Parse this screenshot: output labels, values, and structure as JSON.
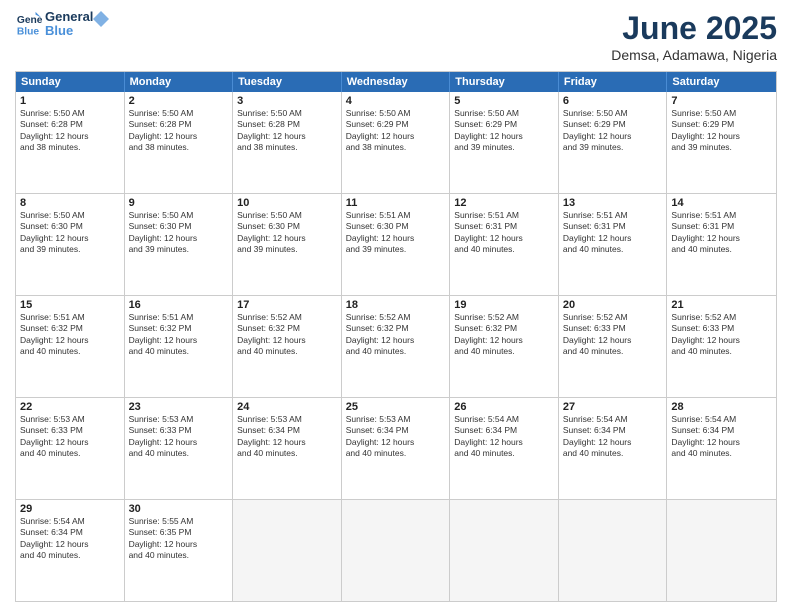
{
  "header": {
    "logo_line1": "General",
    "logo_line2": "Blue",
    "month": "June 2025",
    "location": "Demsa, Adamawa, Nigeria"
  },
  "weekdays": [
    "Sunday",
    "Monday",
    "Tuesday",
    "Wednesday",
    "Thursday",
    "Friday",
    "Saturday"
  ],
  "rows": [
    [
      {
        "day": "1",
        "lines": [
          "Sunrise: 5:50 AM",
          "Sunset: 6:28 PM",
          "Daylight: 12 hours",
          "and 38 minutes."
        ]
      },
      {
        "day": "2",
        "lines": [
          "Sunrise: 5:50 AM",
          "Sunset: 6:28 PM",
          "Daylight: 12 hours",
          "and 38 minutes."
        ]
      },
      {
        "day": "3",
        "lines": [
          "Sunrise: 5:50 AM",
          "Sunset: 6:28 PM",
          "Daylight: 12 hours",
          "and 38 minutes."
        ]
      },
      {
        "day": "4",
        "lines": [
          "Sunrise: 5:50 AM",
          "Sunset: 6:29 PM",
          "Daylight: 12 hours",
          "and 38 minutes."
        ]
      },
      {
        "day": "5",
        "lines": [
          "Sunrise: 5:50 AM",
          "Sunset: 6:29 PM",
          "Daylight: 12 hours",
          "and 39 minutes."
        ]
      },
      {
        "day": "6",
        "lines": [
          "Sunrise: 5:50 AM",
          "Sunset: 6:29 PM",
          "Daylight: 12 hours",
          "and 39 minutes."
        ]
      },
      {
        "day": "7",
        "lines": [
          "Sunrise: 5:50 AM",
          "Sunset: 6:29 PM",
          "Daylight: 12 hours",
          "and 39 minutes."
        ]
      }
    ],
    [
      {
        "day": "8",
        "lines": [
          "Sunrise: 5:50 AM",
          "Sunset: 6:30 PM",
          "Daylight: 12 hours",
          "and 39 minutes."
        ]
      },
      {
        "day": "9",
        "lines": [
          "Sunrise: 5:50 AM",
          "Sunset: 6:30 PM",
          "Daylight: 12 hours",
          "and 39 minutes."
        ]
      },
      {
        "day": "10",
        "lines": [
          "Sunrise: 5:50 AM",
          "Sunset: 6:30 PM",
          "Daylight: 12 hours",
          "and 39 minutes."
        ]
      },
      {
        "day": "11",
        "lines": [
          "Sunrise: 5:51 AM",
          "Sunset: 6:30 PM",
          "Daylight: 12 hours",
          "and 39 minutes."
        ]
      },
      {
        "day": "12",
        "lines": [
          "Sunrise: 5:51 AM",
          "Sunset: 6:31 PM",
          "Daylight: 12 hours",
          "and 40 minutes."
        ]
      },
      {
        "day": "13",
        "lines": [
          "Sunrise: 5:51 AM",
          "Sunset: 6:31 PM",
          "Daylight: 12 hours",
          "and 40 minutes."
        ]
      },
      {
        "day": "14",
        "lines": [
          "Sunrise: 5:51 AM",
          "Sunset: 6:31 PM",
          "Daylight: 12 hours",
          "and 40 minutes."
        ]
      }
    ],
    [
      {
        "day": "15",
        "lines": [
          "Sunrise: 5:51 AM",
          "Sunset: 6:32 PM",
          "Daylight: 12 hours",
          "and 40 minutes."
        ]
      },
      {
        "day": "16",
        "lines": [
          "Sunrise: 5:51 AM",
          "Sunset: 6:32 PM",
          "Daylight: 12 hours",
          "and 40 minutes."
        ]
      },
      {
        "day": "17",
        "lines": [
          "Sunrise: 5:52 AM",
          "Sunset: 6:32 PM",
          "Daylight: 12 hours",
          "and 40 minutes."
        ]
      },
      {
        "day": "18",
        "lines": [
          "Sunrise: 5:52 AM",
          "Sunset: 6:32 PM",
          "Daylight: 12 hours",
          "and 40 minutes."
        ]
      },
      {
        "day": "19",
        "lines": [
          "Sunrise: 5:52 AM",
          "Sunset: 6:32 PM",
          "Daylight: 12 hours",
          "and 40 minutes."
        ]
      },
      {
        "day": "20",
        "lines": [
          "Sunrise: 5:52 AM",
          "Sunset: 6:33 PM",
          "Daylight: 12 hours",
          "and 40 minutes."
        ]
      },
      {
        "day": "21",
        "lines": [
          "Sunrise: 5:52 AM",
          "Sunset: 6:33 PM",
          "Daylight: 12 hours",
          "and 40 minutes."
        ]
      }
    ],
    [
      {
        "day": "22",
        "lines": [
          "Sunrise: 5:53 AM",
          "Sunset: 6:33 PM",
          "Daylight: 12 hours",
          "and 40 minutes."
        ]
      },
      {
        "day": "23",
        "lines": [
          "Sunrise: 5:53 AM",
          "Sunset: 6:33 PM",
          "Daylight: 12 hours",
          "and 40 minutes."
        ]
      },
      {
        "day": "24",
        "lines": [
          "Sunrise: 5:53 AM",
          "Sunset: 6:34 PM",
          "Daylight: 12 hours",
          "and 40 minutes."
        ]
      },
      {
        "day": "25",
        "lines": [
          "Sunrise: 5:53 AM",
          "Sunset: 6:34 PM",
          "Daylight: 12 hours",
          "and 40 minutes."
        ]
      },
      {
        "day": "26",
        "lines": [
          "Sunrise: 5:54 AM",
          "Sunset: 6:34 PM",
          "Daylight: 12 hours",
          "and 40 minutes."
        ]
      },
      {
        "day": "27",
        "lines": [
          "Sunrise: 5:54 AM",
          "Sunset: 6:34 PM",
          "Daylight: 12 hours",
          "and 40 minutes."
        ]
      },
      {
        "day": "28",
        "lines": [
          "Sunrise: 5:54 AM",
          "Sunset: 6:34 PM",
          "Daylight: 12 hours",
          "and 40 minutes."
        ]
      }
    ],
    [
      {
        "day": "29",
        "lines": [
          "Sunrise: 5:54 AM",
          "Sunset: 6:34 PM",
          "Daylight: 12 hours",
          "and 40 minutes."
        ]
      },
      {
        "day": "30",
        "lines": [
          "Sunrise: 5:55 AM",
          "Sunset: 6:35 PM",
          "Daylight: 12 hours",
          "and 40 minutes."
        ]
      },
      {
        "day": "",
        "lines": []
      },
      {
        "day": "",
        "lines": []
      },
      {
        "day": "",
        "lines": []
      },
      {
        "day": "",
        "lines": []
      },
      {
        "day": "",
        "lines": []
      }
    ]
  ]
}
